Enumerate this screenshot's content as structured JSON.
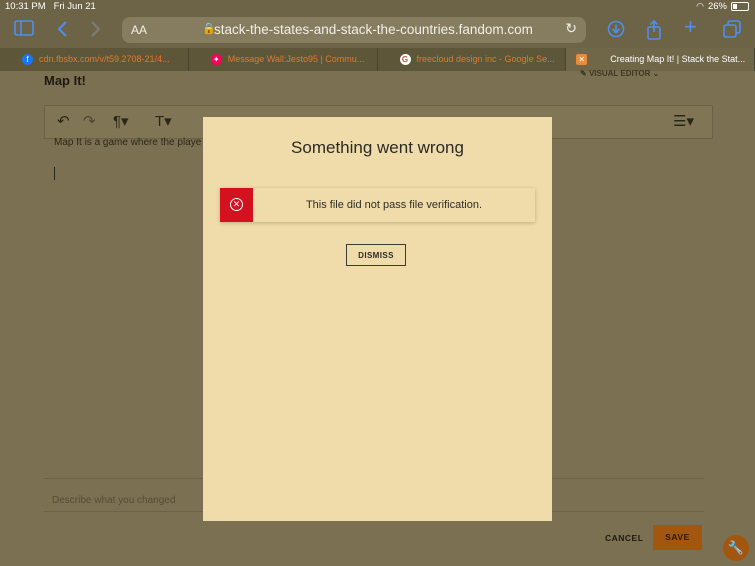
{
  "status_bar": {
    "time": "10:31 PM",
    "date": "Fri Jun 21",
    "battery": "26%"
  },
  "address_bar": {
    "text_size_label": "AA",
    "url": "stack-the-states-and-stack-the-countries.fandom.com"
  },
  "tabs": [
    {
      "label": "cdn.fbsbx.com/v/t59.2708-21/4...",
      "icon": "facebook-icon"
    },
    {
      "label": "Message Wall:Jesto95 | Commu...",
      "icon": "fandom-icon"
    },
    {
      "label": "freecloud design inc - Google Se...",
      "icon": "google-icon"
    },
    {
      "label": "Creating Map It! | Stack the Stat...",
      "icon": "close-icon",
      "active": true
    }
  ],
  "page": {
    "title": "Map It!",
    "mode_label": "VISUAL EDITOR",
    "body_text": "Map It is a game where the playe",
    "summary_placeholder": "Describe what you changed",
    "cancel_label": "CANCEL",
    "save_label": "SAVE"
  },
  "modal": {
    "title": "Something went wrong",
    "message": "This file did not pass file verification.",
    "dismiss_label": "DISMISS"
  },
  "colors": {
    "modal_bg": "#efdcaa",
    "error_red": "#d3111f",
    "safari_blue": "#4d8ff0",
    "save_orange": "#a3560f"
  }
}
